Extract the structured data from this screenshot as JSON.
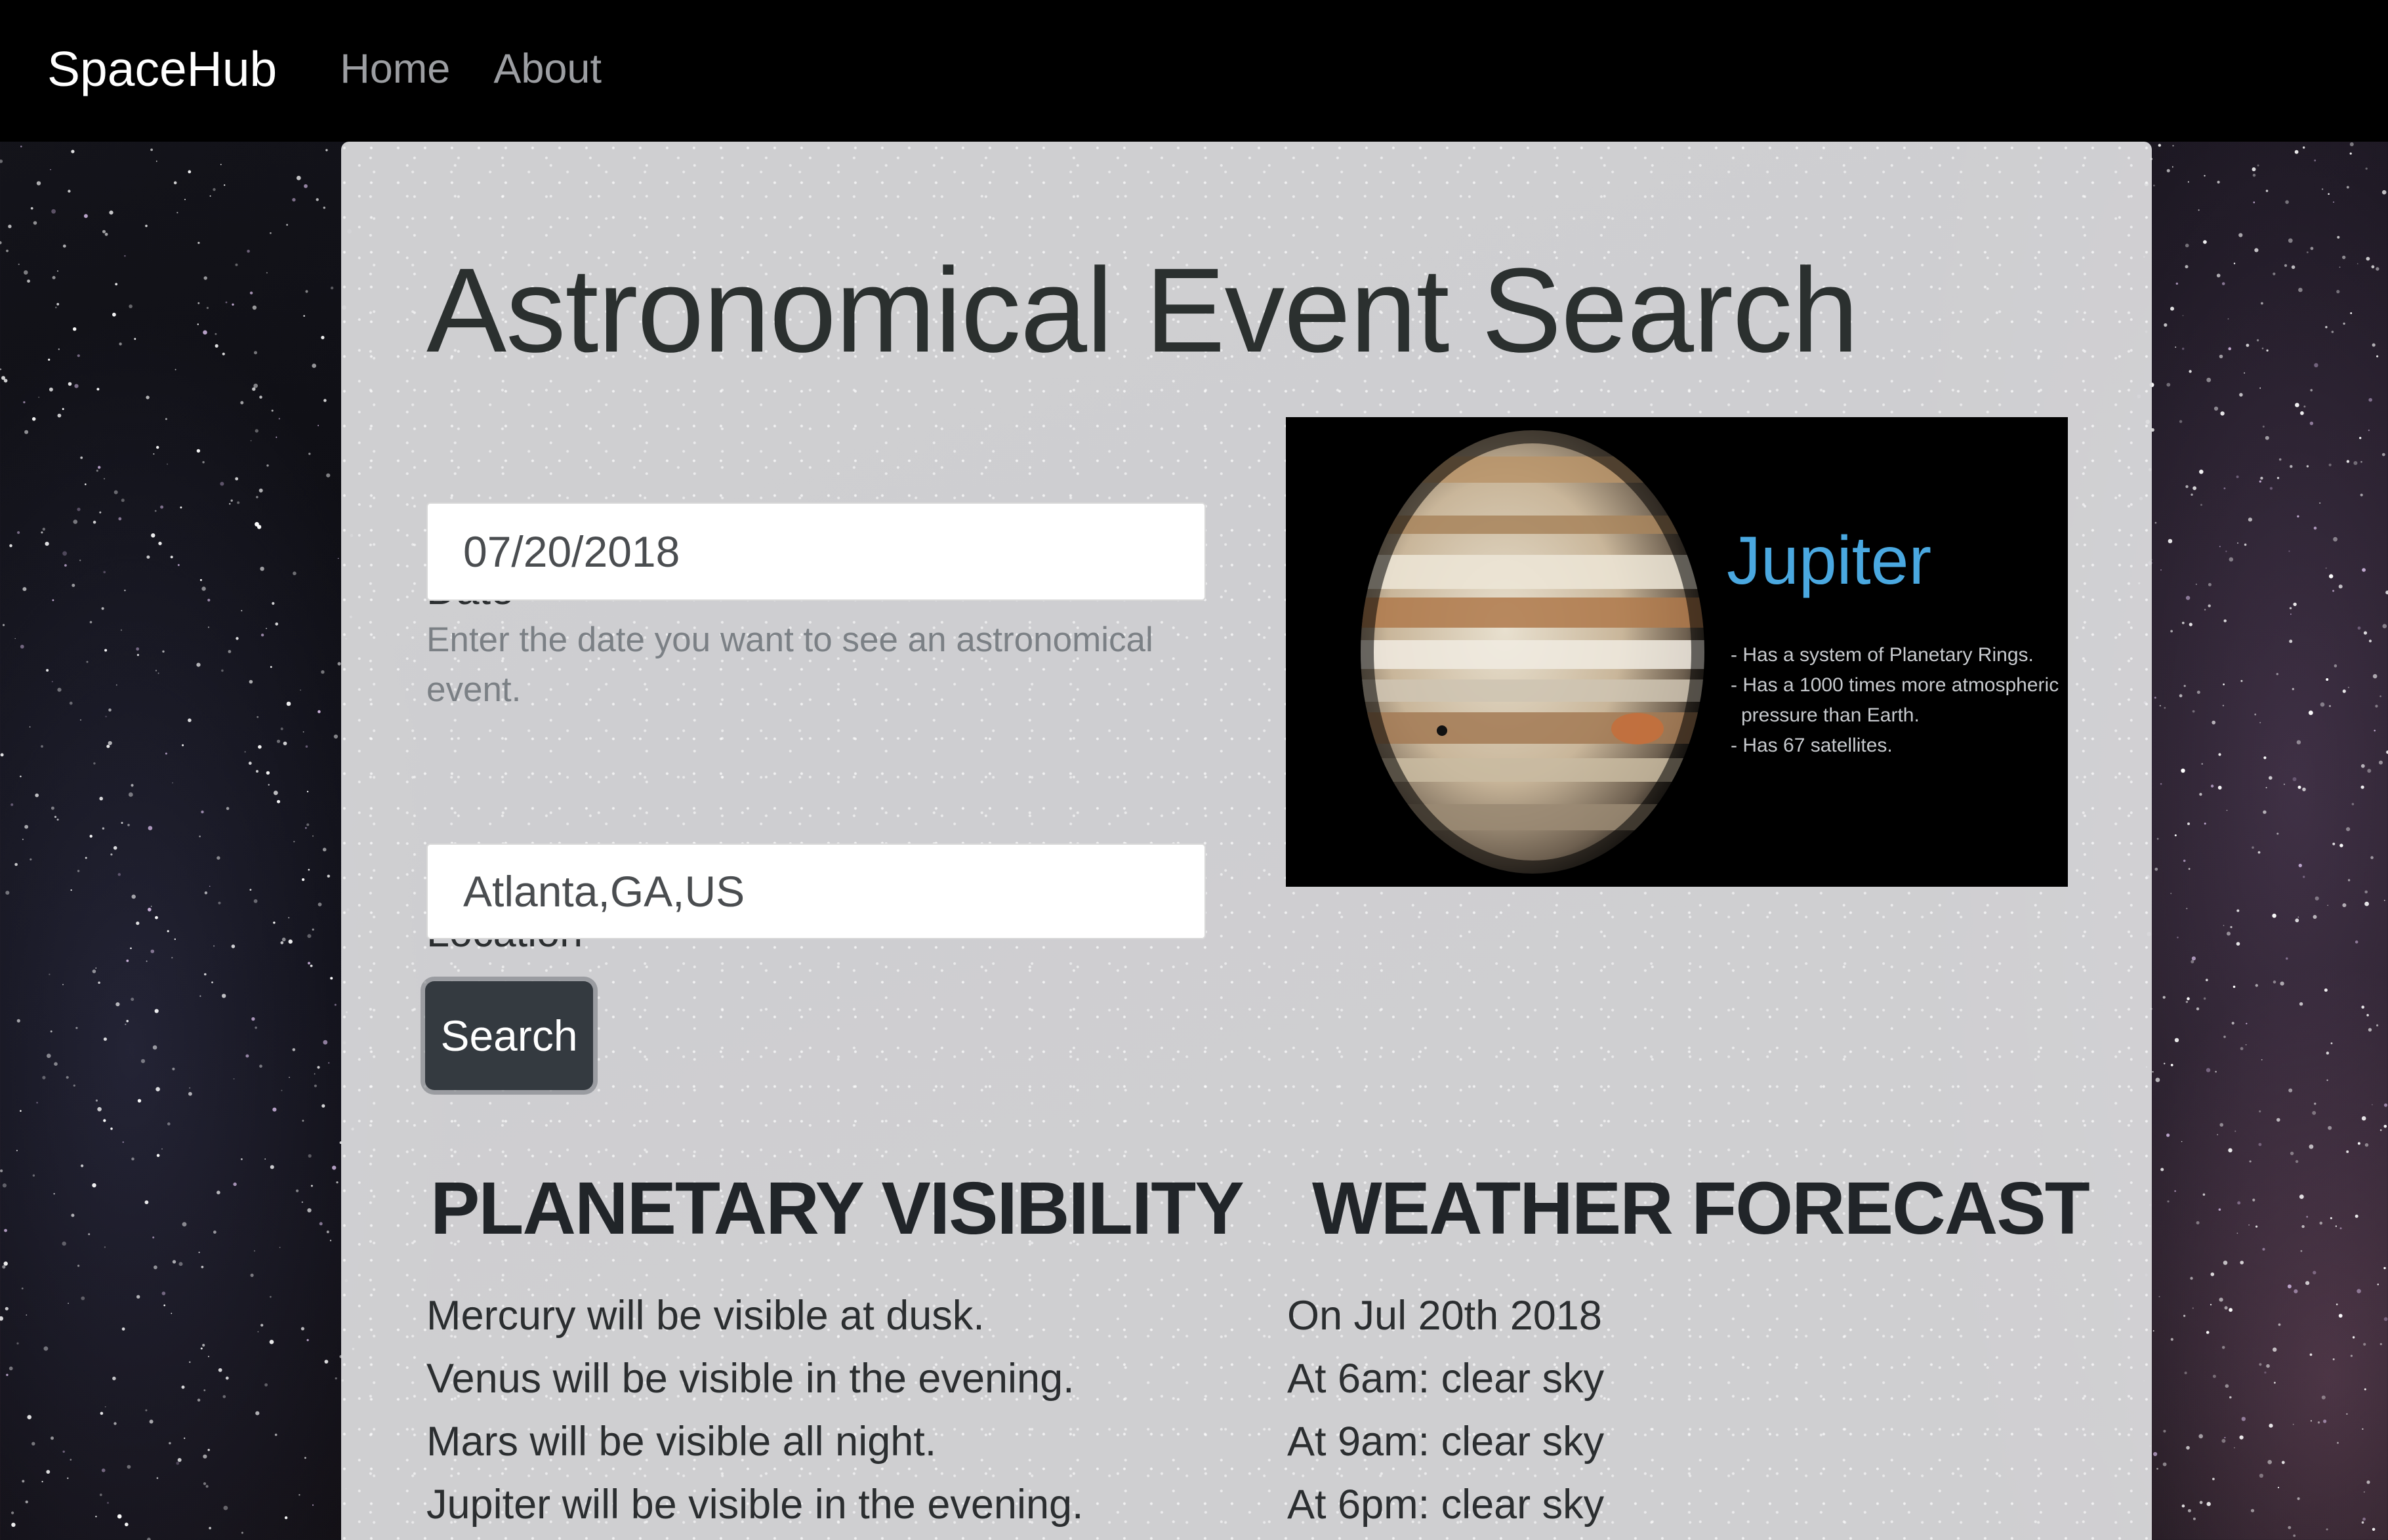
{
  "navbar": {
    "brand": "SpaceHub",
    "links": [
      "Home",
      "About"
    ]
  },
  "main": {
    "title": "Astronomical Event Search",
    "date": {
      "label": "Date",
      "value": "07/20/2018",
      "help": "Enter the date you want to see an astronomical event."
    },
    "location": {
      "label": "Location",
      "value": "Atlanta,GA,US"
    },
    "search_button": "Search",
    "planet_card": {
      "name": "Jupiter",
      "facts": [
        "- Has a system of Planetary Rings.",
        "- Has a 1000 times more atmospheric",
        "pressure than Earth.",
        "- Has 67 satellites."
      ]
    },
    "planetary_visibility": {
      "heading": "PLANETARY VISIBILITY",
      "items": [
        "Mercury will be visible at dusk.",
        "Venus will be visible in the evening.",
        "Mars will be visible all night.",
        "Jupiter will be visible in the evening."
      ]
    },
    "weather_forecast": {
      "heading": "WEATHER FORECAST",
      "items": [
        "On Jul 20th 2018",
        "At 6am: clear sky",
        "At 9am: clear sky",
        "At 6pm: clear sky"
      ]
    }
  },
  "colors": {
    "navbar_bg": "#000000",
    "button_bg": "#343a40",
    "planet_label": "#4aa8e0"
  }
}
